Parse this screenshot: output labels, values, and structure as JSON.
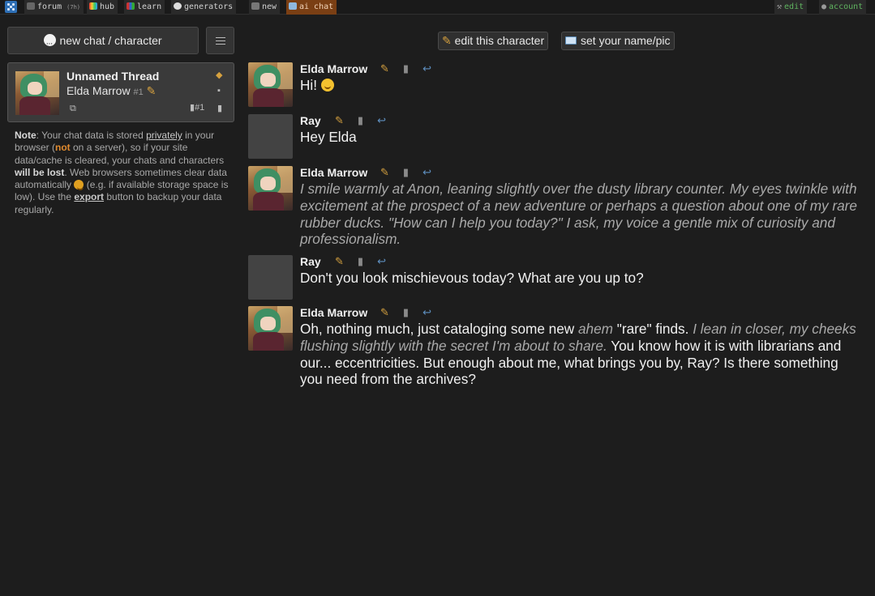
{
  "topbar": {
    "forum_label": "forum",
    "forum_badge": "(7h)",
    "hub_label": "hub",
    "learn_label": "learn",
    "generators_label": "generators",
    "new_label": "new",
    "ai_chat_label": "ai chat",
    "edit_label": "edit",
    "account_label": "account"
  },
  "sidebar": {
    "new_chat_label": "new chat / character",
    "thread": {
      "title": "Unnamed Thread",
      "character": "Elda Marrow",
      "number": "#1",
      "count_label": "#1"
    },
    "note": {
      "prefix": "Note",
      "t1": ": Your chat data is stored ",
      "privately": "privately",
      "t2": " in your browser (",
      "not": "not",
      "t3": " on a server), so if your site data/cache is cleared, your chats and characters ",
      "will_be_lost": "will be lost",
      "t4": ". Web browsers sometimes clear data automatically ",
      "t5": " (e.g. if available storage space is low). Use the ",
      "export": "export",
      "t6": " button to backup your data regularly."
    }
  },
  "header": {
    "edit_character_label": "edit this character",
    "set_name_label": "set your name/pic"
  },
  "messages": [
    {
      "author": "Elda Marrow",
      "text": "Hi!"
    },
    {
      "author": "Ray",
      "text": "Hey Elda"
    },
    {
      "author": "Elda Marrow",
      "italic": "I smile warmly at Anon, leaning slightly over the dusty library counter. My eyes twinkle with excitement at the prospect of a new adventure or perhaps a question about one of my rare rubber ducks. \"How can I help you today?\" I ask, my voice a gentle mix of curiosity and professionalism."
    },
    {
      "author": "Ray",
      "text": "Don't you look mischievous today? What are you up to?"
    },
    {
      "author": "Elda Marrow",
      "p1": "Oh, nothing much, just cataloging some new ",
      "ahem": "ahem",
      "p2": " \"rare\" finds. ",
      "italic": "I lean in closer, my cheeks flushing slightly with the secret I'm about to share.",
      "p3": " You know how it is with librarians and our... eccentricities. But enough about me, what brings you by, Ray? Is there something you need from the archives?"
    }
  ],
  "icons": {
    "logo": "perchance-dice-icon",
    "edit": "pencil-icon",
    "delete": "trash-icon",
    "reply": "reply-arrow-icon"
  },
  "colors": {
    "background": "#1d1d1d",
    "active_tab": "#7a3f14",
    "warn": "#e08a2e",
    "account_green": "#5fb35f"
  }
}
